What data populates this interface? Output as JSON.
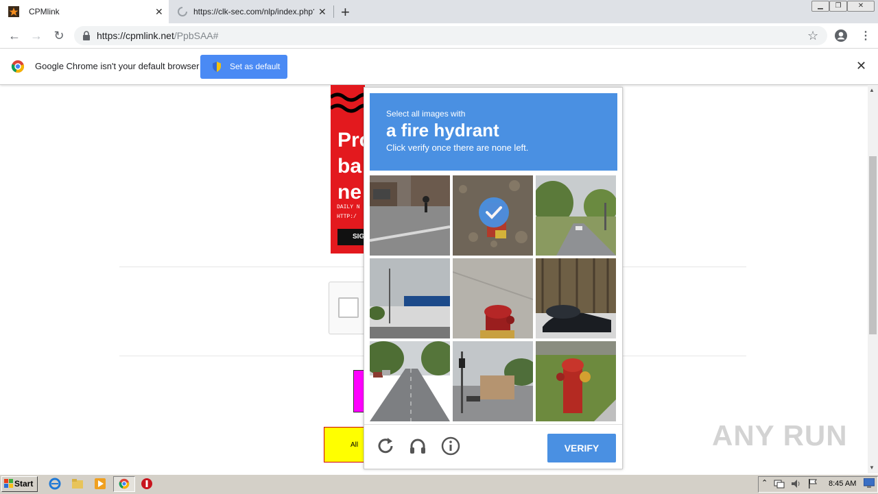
{
  "browser": {
    "tabs": [
      {
        "title": "CPMlink",
        "active": true
      },
      {
        "title": "https://clk-sec.com/nlp/index.php?a",
        "active": false
      }
    ],
    "url_host": "https://cpmlink.net",
    "url_path": "/PpbSAA#",
    "infobar": {
      "text": "Google Chrome isn't your default browser",
      "button": "Set as default"
    }
  },
  "page": {
    "ad": {
      "headline": "Pro\nba\nne",
      "small_text": "DAILY N\nHTTP:/",
      "button": "SIG"
    },
    "yellow_box_text": "All"
  },
  "captcha": {
    "instruction": "Select all images with",
    "target": "a fire hydrant",
    "hint": "Click verify once there are none left.",
    "verify_label": "VERIFY",
    "selected_tiles": [
      1
    ]
  },
  "watermark": "ANY RUN",
  "taskbar": {
    "start_label": "Start",
    "clock": "8:45 AM"
  },
  "colors": {
    "accent": "#4a90e2",
    "chrome_button": "#4a8af4",
    "ad_red": "#e3191e"
  }
}
